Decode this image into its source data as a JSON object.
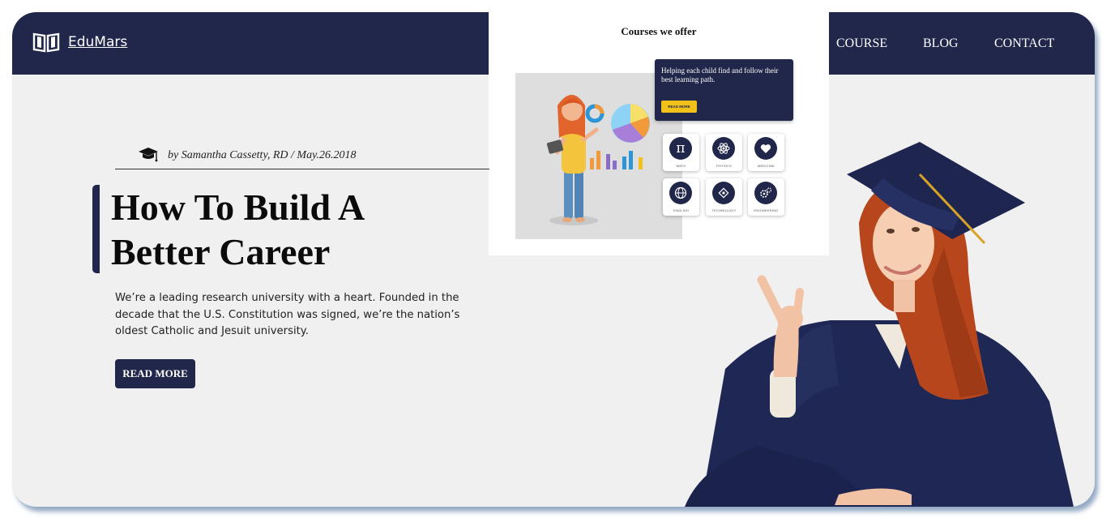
{
  "brand": {
    "name": "EduMars",
    "icon": "open-book-icon"
  },
  "nav": {
    "items": [
      {
        "label": "COURSE"
      },
      {
        "label": "BLOG"
      },
      {
        "label": "CONTACT"
      }
    ]
  },
  "courses_popup": {
    "title": "Courses we offer",
    "promo_text": "Helping each child find and follow their best learning path.",
    "promo_button": "READ MORE",
    "courses": [
      {
        "label": "MATH",
        "icon": "pi-icon"
      },
      {
        "label": "PHYSICS",
        "icon": "atom-icon"
      },
      {
        "label": "MEDICINE",
        "icon": "heart-icon"
      },
      {
        "label": "ENGLISH",
        "icon": "globe-icon"
      },
      {
        "label": "TECHNOLOGY",
        "icon": "chip-icon"
      },
      {
        "label": "ENGINEERING",
        "icon": "gears-icon"
      }
    ]
  },
  "post": {
    "byline": "by Samantha Cassetty, RD / May.26.2018",
    "title_line1": "How To Build A",
    "title_line2": "Better Career",
    "description": "We’re a leading research university with a heart. Founded in the decade that the U.S. Constitution was signed, we’re the nation’s oldest Catholic and Jesuit university.",
    "cta": "READ MORE"
  },
  "colors": {
    "navy": "#21274a",
    "accent": "#f2c21b",
    "background": "#f0f0f0"
  }
}
